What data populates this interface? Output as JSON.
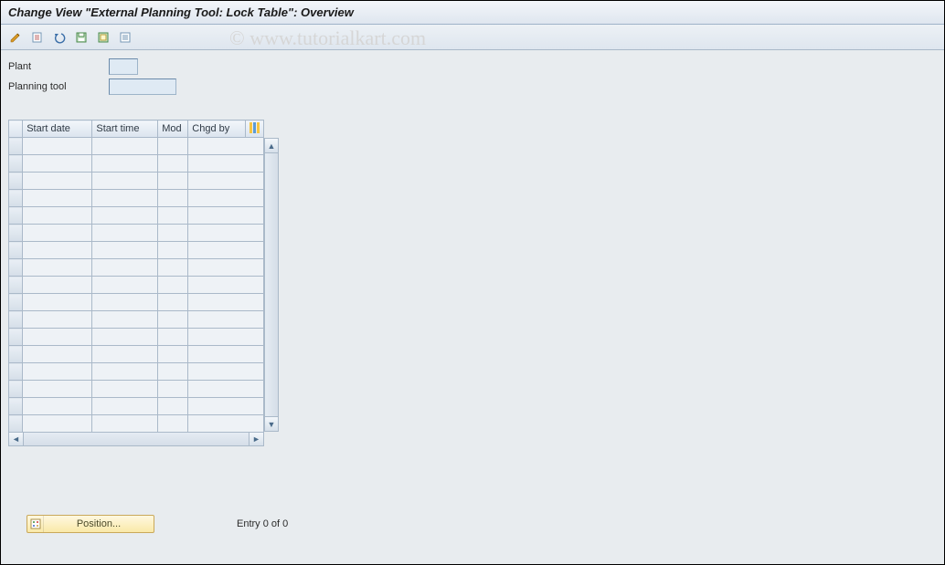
{
  "title": "Change View \"External Planning Tool: Lock Table\": Overview",
  "watermark": "© www.tutorialkart.com",
  "toolbar_icons": [
    "change",
    "new-entries",
    "undo",
    "save-row",
    "select-all",
    "deselect"
  ],
  "form": {
    "plant_label": "Plant",
    "plant_value": "",
    "planning_tool_label": "Planning tool",
    "planning_tool_value": ""
  },
  "table": {
    "columns": [
      "Start date",
      "Start time",
      "Mod",
      "Chgd by"
    ],
    "rows_count": 17
  },
  "footer": {
    "position_label": "Position...",
    "entry_label": "Entry 0 of 0"
  }
}
